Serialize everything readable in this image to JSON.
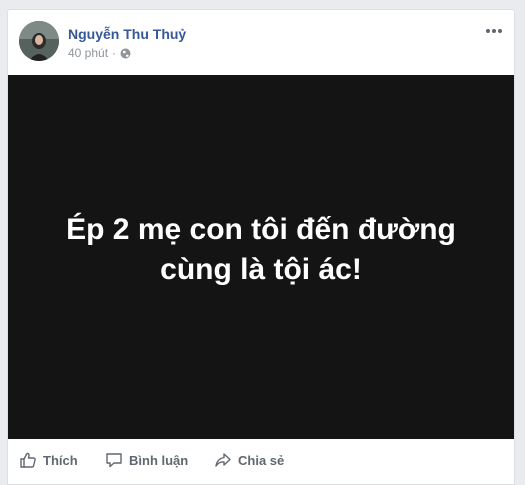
{
  "post": {
    "author_name": "Nguyễn Thu Thuỷ",
    "time_text": "40 phút",
    "separator": "·",
    "privacy_icon": "globe-icon",
    "more_icon": "more-horizontal-icon",
    "media": {
      "background_color": "#141414",
      "text_color": "#ffffff",
      "lines": [
        "Ép 2 mẹ con tôi đến đường",
        "cùng là tội ác!"
      ]
    }
  },
  "actions": {
    "like_label": "Thích",
    "comment_label": "Bình luận",
    "share_label": "Chia sẻ"
  },
  "colors": {
    "author_link": "#365899",
    "meta_text": "#90949c",
    "action_text": "#616770",
    "page_bg": "#e9ebee"
  }
}
